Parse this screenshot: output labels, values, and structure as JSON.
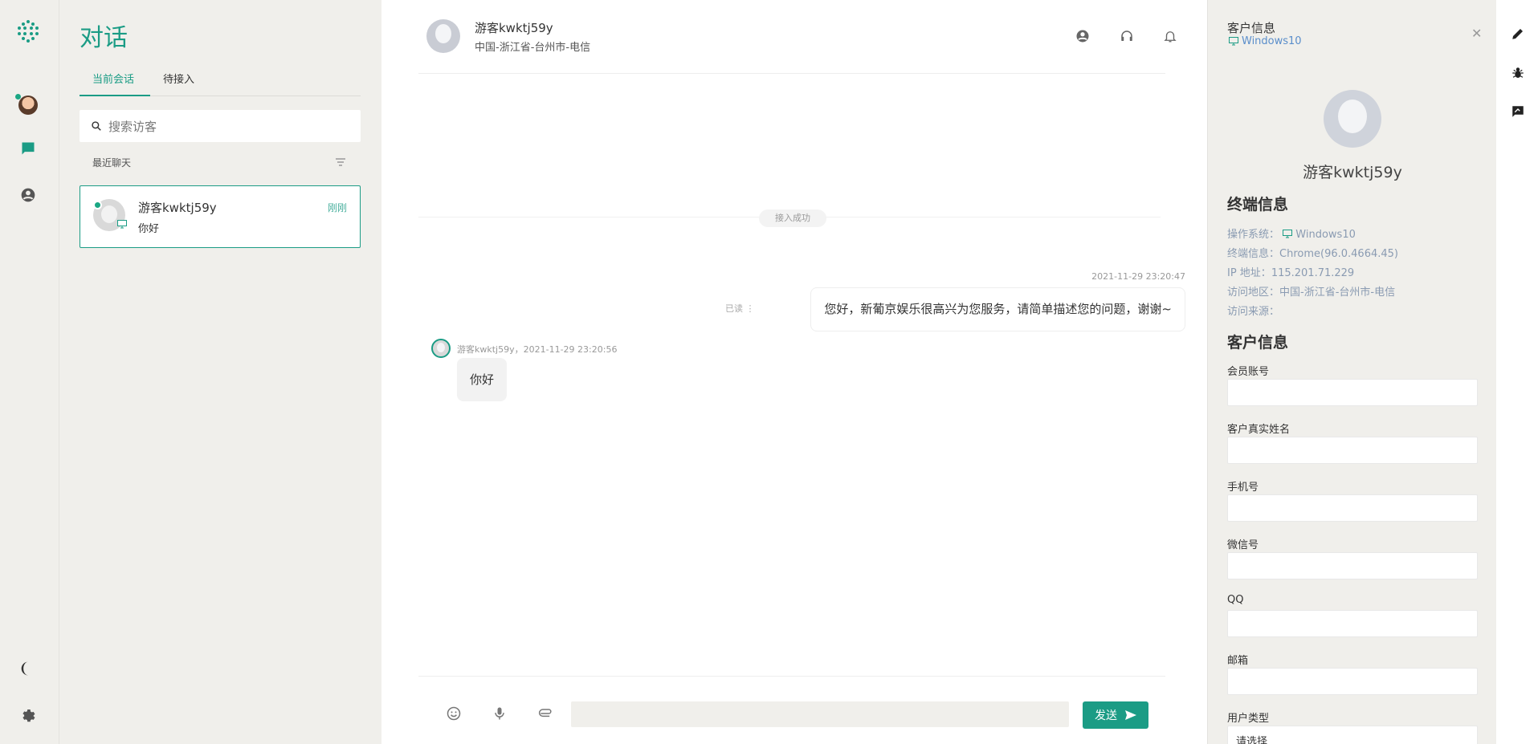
{
  "rail": {
    "brand_icon": "dots-grid-logo-icon",
    "items": [
      "avatar",
      "chat-icon",
      "user-circle-icon"
    ],
    "bottom": [
      "moon-icon",
      "gear-icon"
    ]
  },
  "sessions": {
    "title": "对话",
    "tabs": [
      {
        "label": "当前会话",
        "active": true
      },
      {
        "label": "待接入",
        "active": false
      }
    ],
    "search_placeholder": "搜索访客",
    "recent_label": "最近聊天",
    "list": [
      {
        "name": "游客kwktj59y",
        "last_message": "你好",
        "time": "刚刚"
      }
    ]
  },
  "chat": {
    "header": {
      "name": "游客kwktj59y",
      "location": "中国-浙江省-台州市-电信"
    },
    "system_notice": "接入成功",
    "messages": [
      {
        "side": "right",
        "timestamp": "2021-11-29 23:20:47",
        "status": "已读",
        "text": "您好，新葡京娱乐很高兴为您服务，请简单描述您的问题，谢谢~"
      },
      {
        "side": "left",
        "meta": "游客kwktj59y，2021-11-29 23:20:56",
        "text": "你好"
      }
    ],
    "send_label": "发送"
  },
  "info": {
    "header": "客户信息",
    "os_short": "Windows10",
    "visitor_name": "游客kwktj59y",
    "terminal_section": "终端信息",
    "terminal": [
      {
        "k": "操作系统：",
        "v": "Windows10"
      },
      {
        "k": "终端信息：",
        "v": "Chrome(96.0.4664.45)"
      },
      {
        "k": "IP 地址：",
        "v": "115.201.71.229"
      },
      {
        "k": "访问地区：",
        "v": "中国-浙江省-台州市-电信"
      },
      {
        "k": "访问来源：",
        "v": ""
      }
    ],
    "customer_section": "客户信息",
    "fields": [
      "会员账号",
      "客户真实姓名",
      "手机号",
      "微信号",
      "QQ",
      "邮箱"
    ],
    "user_type_label": "用户类型",
    "user_type_value": "请选择"
  },
  "colors": {
    "accent": "#1b9c85",
    "link": "#5a8ecb"
  }
}
